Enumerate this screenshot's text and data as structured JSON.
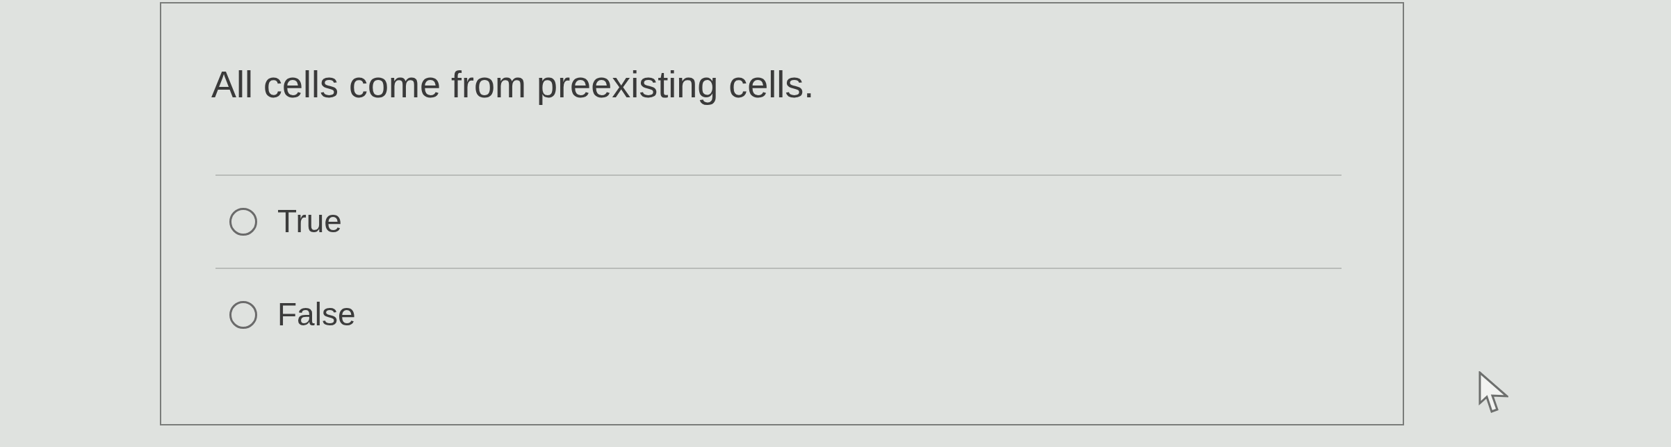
{
  "question": {
    "text": "All cells come from preexisting cells."
  },
  "options": [
    {
      "label": "True",
      "selected": false
    },
    {
      "label": "False",
      "selected": false
    }
  ]
}
